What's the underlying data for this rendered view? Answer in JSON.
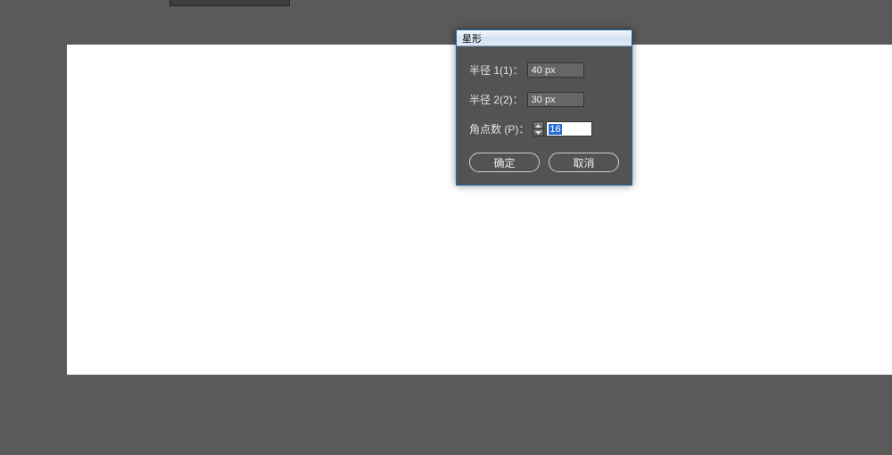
{
  "dialog": {
    "title": "星形",
    "radius1": {
      "label": "半径 1(1)：",
      "value": "40 px"
    },
    "radius2": {
      "label": "半径 2(2)：",
      "value": "30 px"
    },
    "points": {
      "label": "角点数 (P)：",
      "value": "16"
    },
    "ok_label": "确定",
    "cancel_label": "取消"
  }
}
